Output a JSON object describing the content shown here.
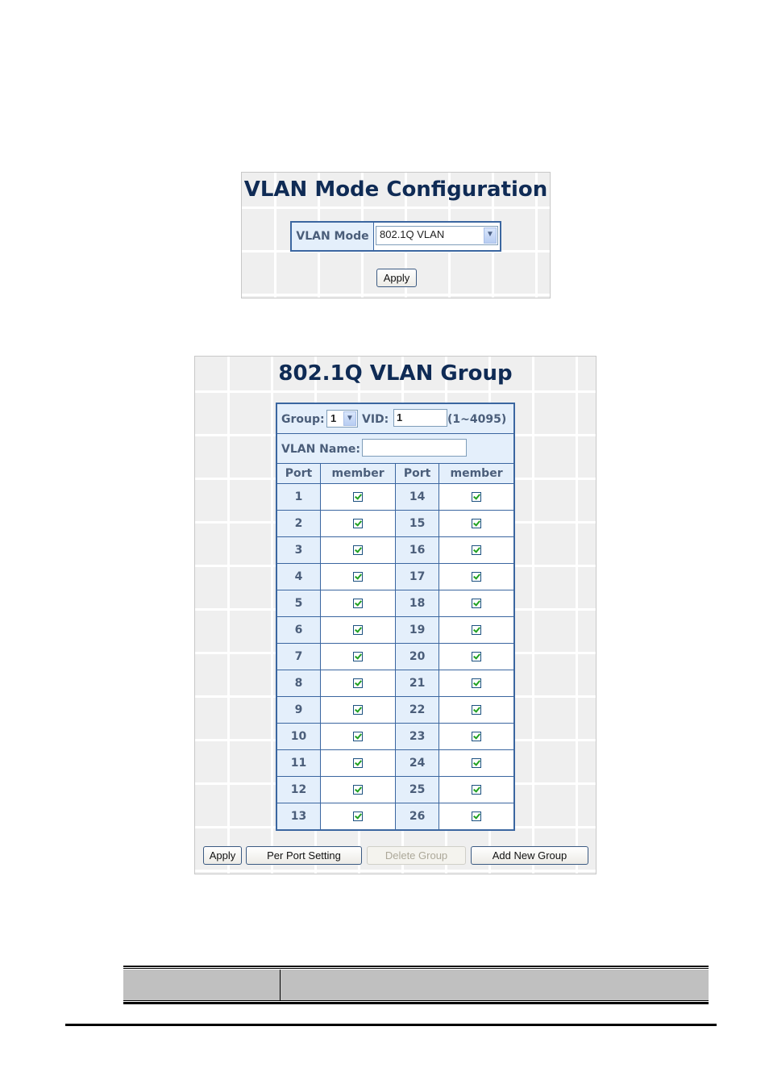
{
  "vlan_mode_panel": {
    "title": "VLAN Mode Configuration",
    "mode_label": "VLAN Mode",
    "mode_value": "802.1Q VLAN",
    "apply_label": "Apply"
  },
  "vlan_group_panel": {
    "title": "802.1Q VLAN Group",
    "group_label": "Group:",
    "group_value": "1",
    "vid_label": "VID:",
    "vid_value": "1",
    "vid_range": "(1~4095)",
    "vlan_name_label": "VLAN Name:",
    "vlan_name_value": "",
    "columns": [
      "Port",
      "member",
      "Port",
      "member"
    ],
    "rows": [
      {
        "left_port": "1",
        "left_member": true,
        "right_port": "14",
        "right_member": true
      },
      {
        "left_port": "2",
        "left_member": true,
        "right_port": "15",
        "right_member": true
      },
      {
        "left_port": "3",
        "left_member": true,
        "right_port": "16",
        "right_member": true
      },
      {
        "left_port": "4",
        "left_member": true,
        "right_port": "17",
        "right_member": true
      },
      {
        "left_port": "5",
        "left_member": true,
        "right_port": "18",
        "right_member": true
      },
      {
        "left_port": "6",
        "left_member": true,
        "right_port": "19",
        "right_member": true
      },
      {
        "left_port": "7",
        "left_member": true,
        "right_port": "20",
        "right_member": true
      },
      {
        "left_port": "8",
        "left_member": true,
        "right_port": "21",
        "right_member": true
      },
      {
        "left_port": "9",
        "left_member": true,
        "right_port": "22",
        "right_member": true
      },
      {
        "left_port": "10",
        "left_member": true,
        "right_port": "23",
        "right_member": true
      },
      {
        "left_port": "11",
        "left_member": true,
        "right_port": "24",
        "right_member": true
      },
      {
        "left_port": "12",
        "left_member": true,
        "right_port": "25",
        "right_member": true
      },
      {
        "left_port": "13",
        "left_member": true,
        "right_port": "26",
        "right_member": true
      }
    ],
    "buttons": {
      "apply": "Apply",
      "per_port_setting": "Per Port Setting",
      "delete_group": "Delete Group",
      "add_new_group": "Add New Group"
    }
  },
  "colors": {
    "title": "#0f2b55",
    "table_border": "#3b66a0",
    "header_bg": "#e4effb",
    "check": "#21a121"
  }
}
